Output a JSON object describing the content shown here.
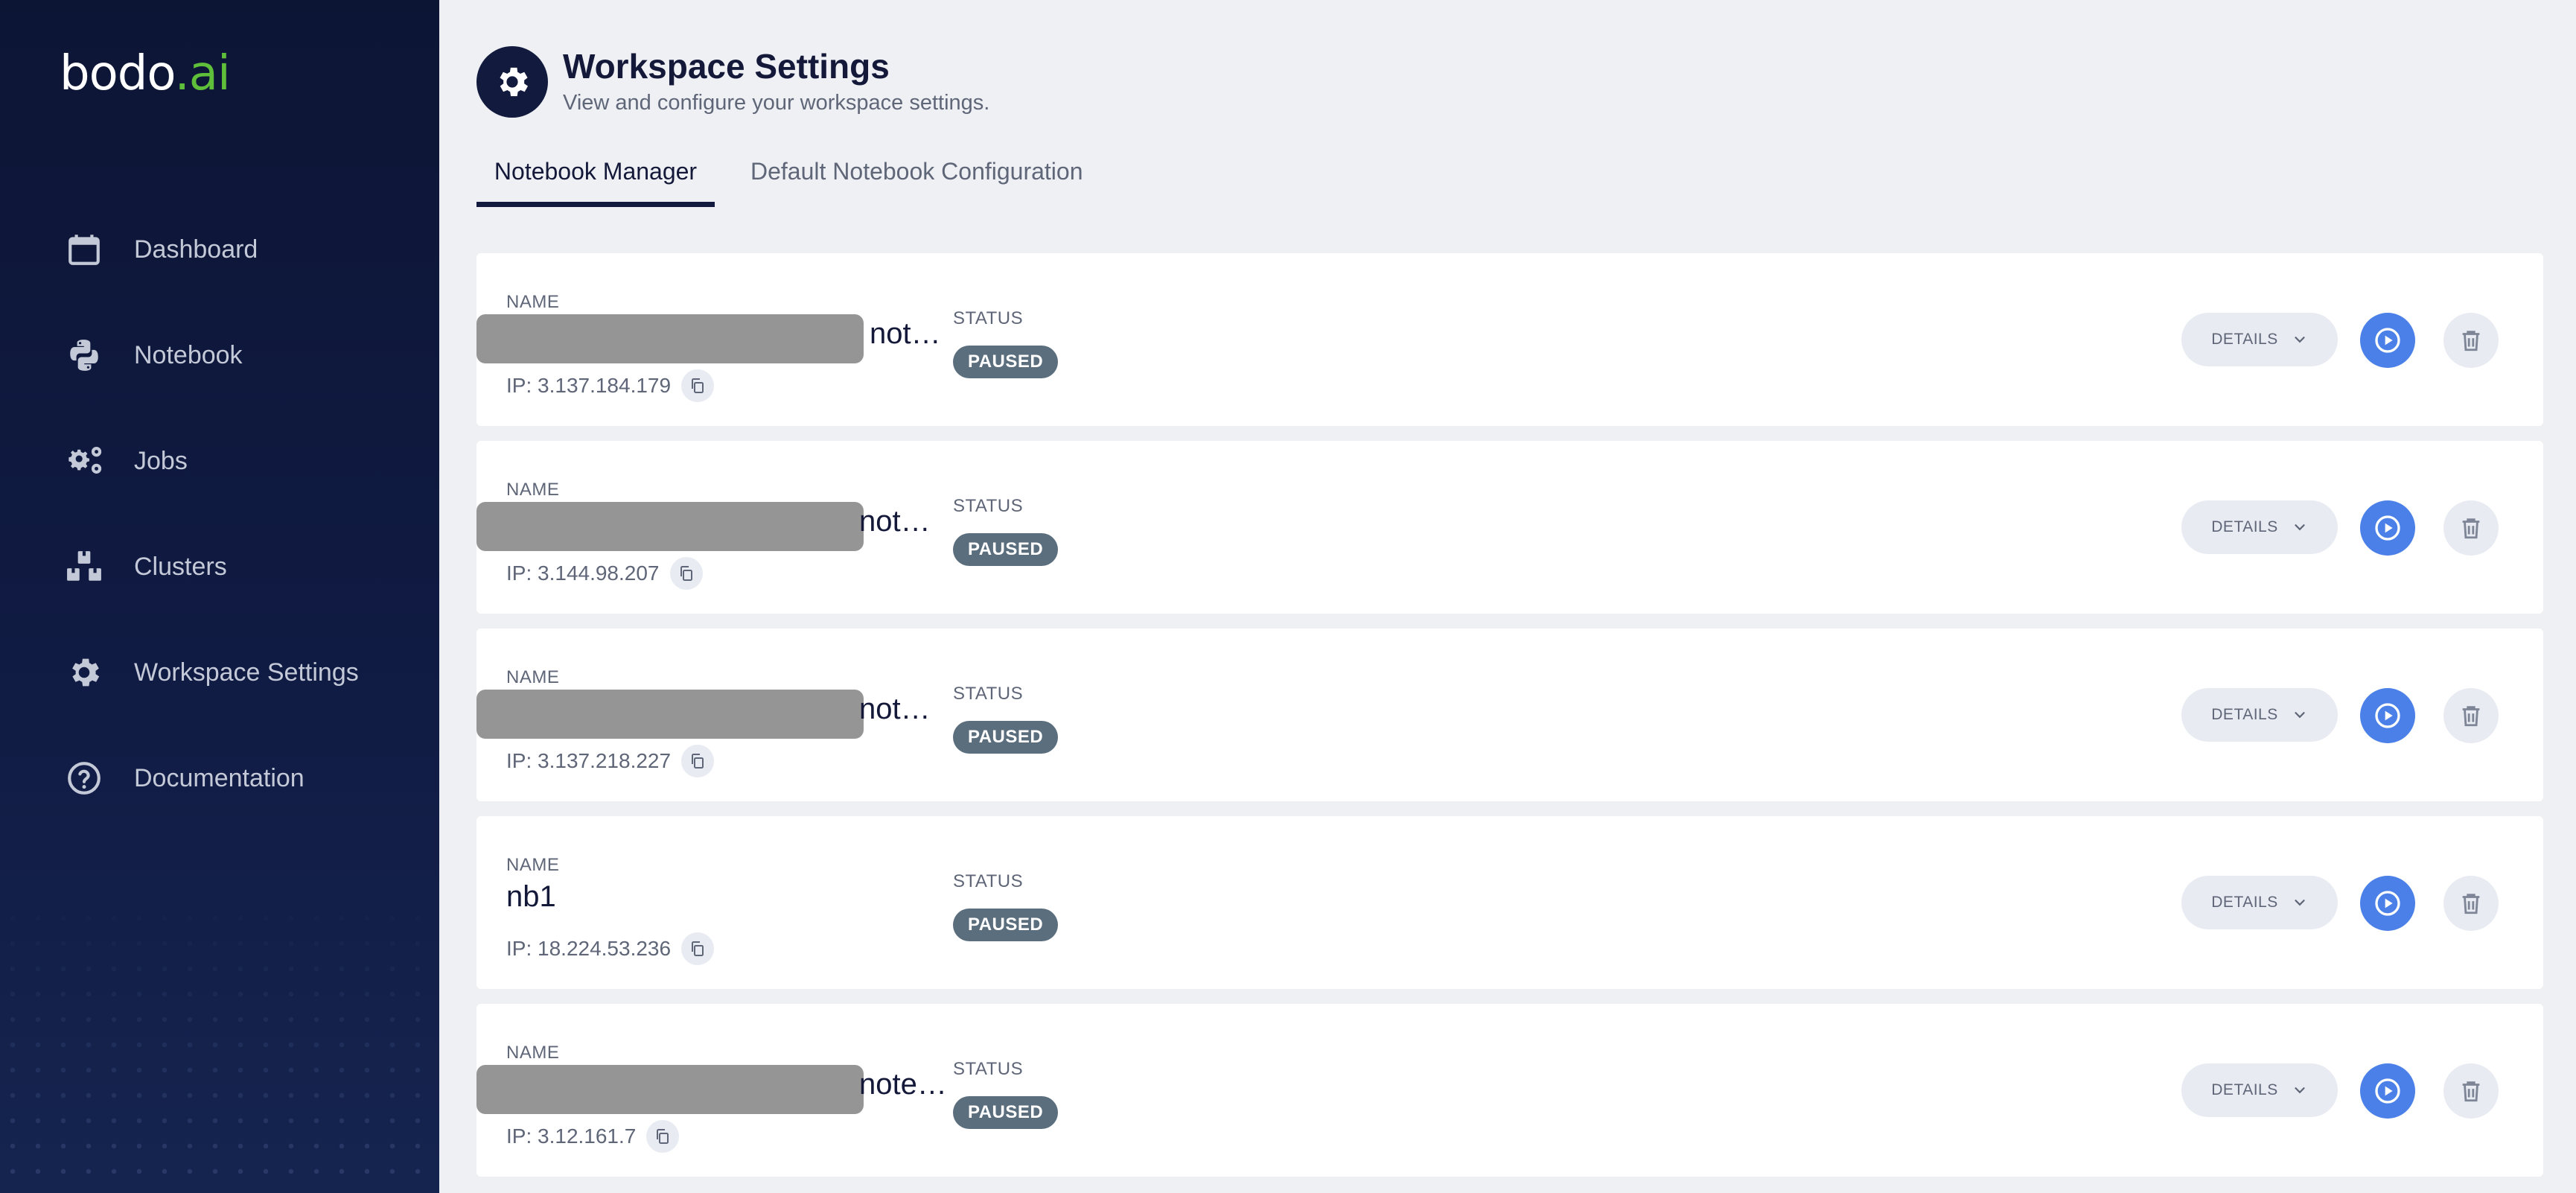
{
  "app": {
    "logo_main": "bodo",
    "logo_accent": ".ai"
  },
  "sidebar": {
    "items": [
      {
        "label": "Dashboard",
        "icon": "calendar-icon"
      },
      {
        "label": "Notebook",
        "icon": "python-icon"
      },
      {
        "label": "Jobs",
        "icon": "gears-icon"
      },
      {
        "label": "Clusters",
        "icon": "boxes-icon"
      },
      {
        "label": "Workspace Settings",
        "icon": "gear-icon"
      },
      {
        "label": "Documentation",
        "icon": "help-circle-icon"
      }
    ]
  },
  "header": {
    "title": "Workspace Settings",
    "subtitle": "View and configure your workspace settings."
  },
  "tabs": [
    {
      "label": "Notebook Manager",
      "active": true
    },
    {
      "label": "Default Notebook Configuration",
      "active": false
    }
  ],
  "labels": {
    "name": "NAME",
    "status": "STATUS",
    "details": "DETAILS"
  },
  "notebooks": [
    {
      "name": "not…",
      "redacted": true,
      "ip": "IP: 3.137.184.179",
      "status": "PAUSED"
    },
    {
      "name": "not…",
      "redacted": true,
      "ip": "IP: 3.144.98.207",
      "status": "PAUSED"
    },
    {
      "name": "not…",
      "redacted": true,
      "ip": "IP: 3.137.218.227",
      "status": "PAUSED"
    },
    {
      "name": "nb1",
      "redacted": false,
      "ip": "IP: 18.224.53.236",
      "status": "PAUSED"
    },
    {
      "name": "note…",
      "redacted": true,
      "ip": "IP: 3.12.161.7",
      "status": "PAUSED"
    }
  ],
  "colors": {
    "sidebar_bg": "#0d1535",
    "accent_green": "#5fbf3a",
    "play_blue": "#4a80e8",
    "badge_gray": "#5b6e7e",
    "active_tab": "#121b3d"
  }
}
